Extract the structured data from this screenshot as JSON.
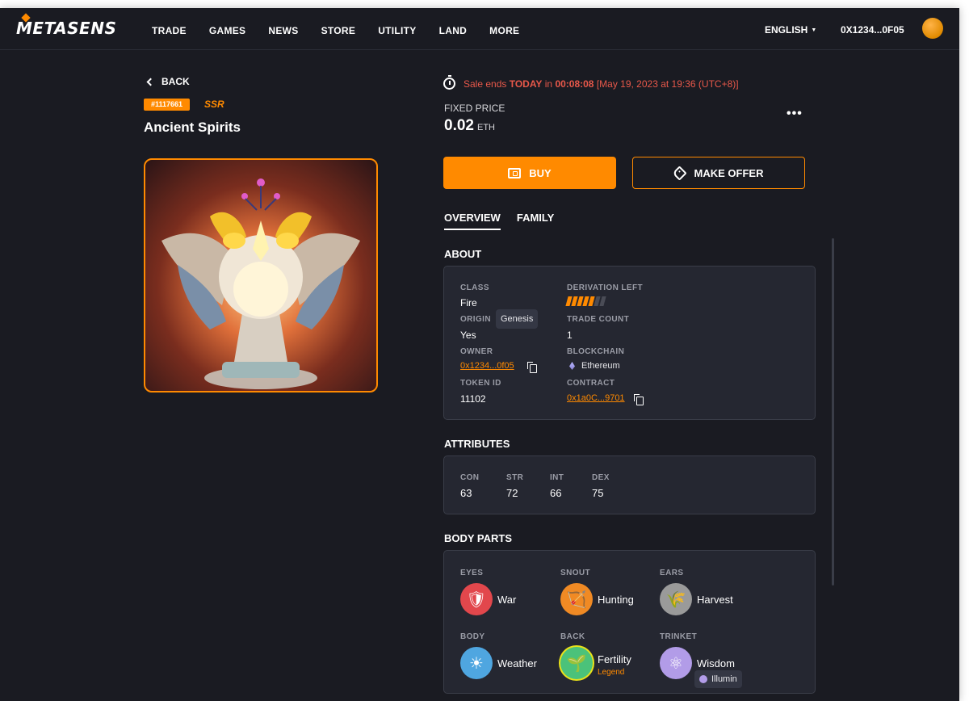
{
  "brand": {
    "name": "METASENS"
  },
  "nav": {
    "items": [
      "TRADE",
      "GAMES",
      "NEWS",
      "STORE",
      "UTILITY",
      "LAND",
      "MORE"
    ]
  },
  "header": {
    "language": "ENGLISH",
    "wallet_address": "0X1234...0F05"
  },
  "item": {
    "back_label": "BACK",
    "id_badge": "#1117661",
    "rarity": "SSR",
    "name": "Ancient Spirits"
  },
  "sale": {
    "prefix": "Sale ends",
    "today": "TODAY",
    "in": "in",
    "countdown": "00:08:08",
    "deadline": "[May 19, 2023 at 19:36 (UTC+8)]"
  },
  "price": {
    "label": "FIXED PRICE",
    "value": "0.02",
    "unit": "ETH"
  },
  "actions": {
    "more": "•••",
    "buy": "BUY",
    "offer": "MAKE OFFER"
  },
  "tabs": [
    {
      "label": "OVERVIEW",
      "active": true
    },
    {
      "label": "FAMILY",
      "active": false
    }
  ],
  "about": {
    "title": "ABOUT",
    "class_label": "CLASS",
    "class_value": "Fire",
    "origin_label": "ORIGIN",
    "origin_value": "Yes",
    "origin_chip": "Genesis",
    "owner_label": "OWNER",
    "owner_value": "0x1234...0f05",
    "token_label": "TOKEN ID",
    "token_value": "11102",
    "derivation_label": "DERIVATION LEFT",
    "derivation_filled": 5,
    "derivation_total": 7,
    "trade_label": "TRADE COUNT",
    "trade_value": "1",
    "chain_label": "BLOCKCHAIN",
    "chain_value": "Ethereum",
    "contract_label": "CONTRACT",
    "contract_value": "0x1a0C...9701"
  },
  "attributes": {
    "title": "ATTRIBUTES",
    "items": [
      {
        "label": "CON",
        "value": "63"
      },
      {
        "label": "STR",
        "value": "72"
      },
      {
        "label": "INT",
        "value": "66"
      },
      {
        "label": "DEX",
        "value": "75"
      }
    ]
  },
  "body_parts": {
    "title": "BODY PARTS",
    "items": [
      {
        "label": "EYES",
        "name": "War",
        "icon": "shield-icon",
        "color": "#e2474c"
      },
      {
        "label": "SNOUT",
        "name": "Hunting",
        "icon": "bow-icon",
        "color": "#f08a24"
      },
      {
        "label": "EARS",
        "name": "Harvest",
        "icon": "wheat-icon",
        "color": "#9a9a9a"
      },
      {
        "label": "BODY",
        "name": "Weather",
        "icon": "sun-icon",
        "color": "#4fa6e0"
      },
      {
        "label": "BACK",
        "name": "Fertility",
        "sub": "Legend",
        "icon": "sprout-icon",
        "color": "#4bc27a"
      },
      {
        "label": "TRINKET",
        "name": "Wisdom",
        "icon": "atom-icon",
        "color": "#b29ce8",
        "chip": "Illumin"
      }
    ]
  },
  "colors": {
    "accent": "#ff8a00",
    "background": "#1a1b22",
    "panel": "#252731",
    "alert": "#e8584a"
  }
}
